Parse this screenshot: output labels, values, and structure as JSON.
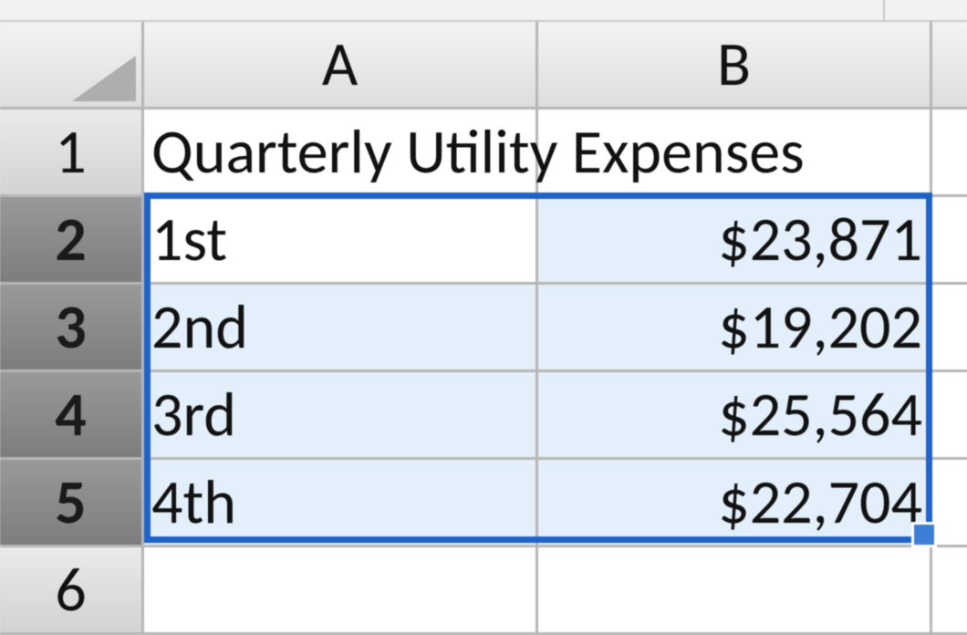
{
  "columns": [
    "A",
    "B"
  ],
  "row_headers": [
    "1",
    "2",
    "3",
    "4",
    "5",
    "6"
  ],
  "selected_row_headers": [
    "2",
    "3",
    "4",
    "5"
  ],
  "selection_range": "A2:B5",
  "active_cell": "A2",
  "title_cell": "Quarterly Utility Expenses",
  "rows": [
    {
      "label": "1st",
      "amount": "$23,871"
    },
    {
      "label": "2nd",
      "amount": "$19,202"
    },
    {
      "label": "3rd",
      "amount": "$25,564"
    },
    {
      "label": "4th",
      "amount": "$22,704"
    }
  ],
  "chart_data": {
    "type": "table",
    "title": "Quarterly Utility Expenses",
    "categories": [
      "1st",
      "2nd",
      "3rd",
      "4th"
    ],
    "values": [
      23871,
      19202,
      25564,
      22704
    ]
  }
}
